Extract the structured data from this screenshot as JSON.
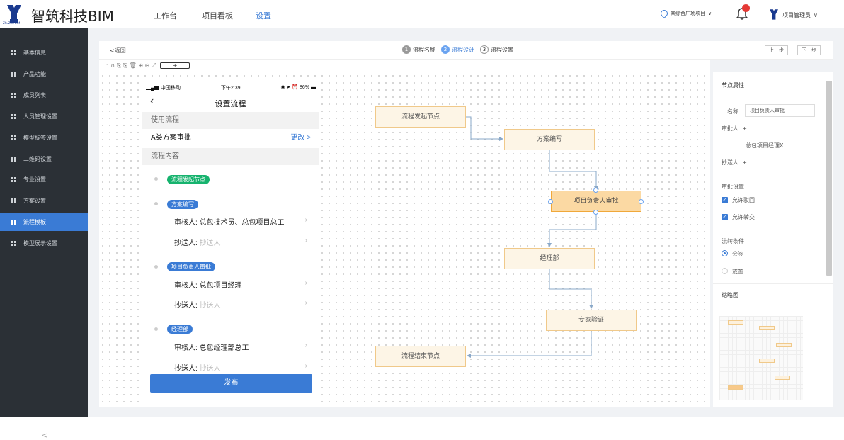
{
  "brand": {
    "name": "智筑科技BIM",
    "logo_sub": "ZhuZhu BIM"
  },
  "nav": {
    "items": [
      {
        "label": "工作台"
      },
      {
        "label": "项目看板"
      },
      {
        "label": "设置"
      }
    ],
    "active": "设置"
  },
  "header": {
    "project": "某综合广场项目",
    "notification_count": "1",
    "user": "项目管理员"
  },
  "sidebar": {
    "items": [
      {
        "label": "基本信息"
      },
      {
        "label": "产品功能"
      },
      {
        "label": "成员列表"
      },
      {
        "label": "人员管理设置"
      },
      {
        "label": "模型标签设置"
      },
      {
        "label": "二维码设置"
      },
      {
        "label": "专业设置"
      },
      {
        "label": "方案设置"
      },
      {
        "label": "流程模板"
      },
      {
        "label": "模型展示设置"
      }
    ],
    "active": "流程模板",
    "collapse": "<"
  },
  "toolbar": {
    "back": "<返回",
    "steps": [
      {
        "num": "1",
        "label": "流程名称"
      },
      {
        "num": "2",
        "label": "流程设计"
      },
      {
        "num": "3",
        "label": "流程设置"
      }
    ],
    "prev": "上一步",
    "next": "下一步"
  },
  "canvas_tools": {
    "icons": "∩ ∩ ⎘ ⎘ 🗑 ⊕ ⊖ ⤢",
    "add": "+"
  },
  "phone": {
    "carrier": "中国移动",
    "time": "下午2:39",
    "battery": "86%",
    "title": "设置流程",
    "use_flow_label": "使用流程",
    "flow_name": "A类方案审批",
    "change": "更改 >",
    "content_label": "流程内容",
    "steps": [
      {
        "tag": "流程发起节点"
      },
      {
        "tag": "方案编写",
        "reviewer": "审核人: 总包技术员、总包项目总工",
        "cc": "抄送人:",
        "cc_placeholder": "抄送人"
      },
      {
        "tag": "项目负责人审批",
        "reviewer": "审核人: 总包项目经理",
        "cc": "抄送人:",
        "cc_placeholder": "抄送人"
      },
      {
        "tag": "经理部",
        "reviewer": "审核人: 总包经理部总工",
        "cc": "抄送人:",
        "cc_placeholder": "抄送人"
      }
    ],
    "publish": "发布"
  },
  "flow": {
    "nodes": [
      {
        "label": "流程发起节点"
      },
      {
        "label": "方案编写"
      },
      {
        "label": "项目负责人审批"
      },
      {
        "label": "经理部"
      },
      {
        "label": "专家验证"
      },
      {
        "label": "流程结束节点"
      }
    ]
  },
  "panel": {
    "title": "节点属性",
    "name_label": "名称:",
    "name_value": "项目负责人审批",
    "approver_label": "审批人: +",
    "approver_value": "总包项目经理X",
    "cc_label": "抄送人: +",
    "approval_settings": "审批设置",
    "allow_reject": "允许驳回",
    "allow_transfer": "允许转交",
    "flow_condition": "流转条件",
    "countersign": "会签",
    "or_sign": "或签",
    "thumbnail": "缩略图"
  }
}
